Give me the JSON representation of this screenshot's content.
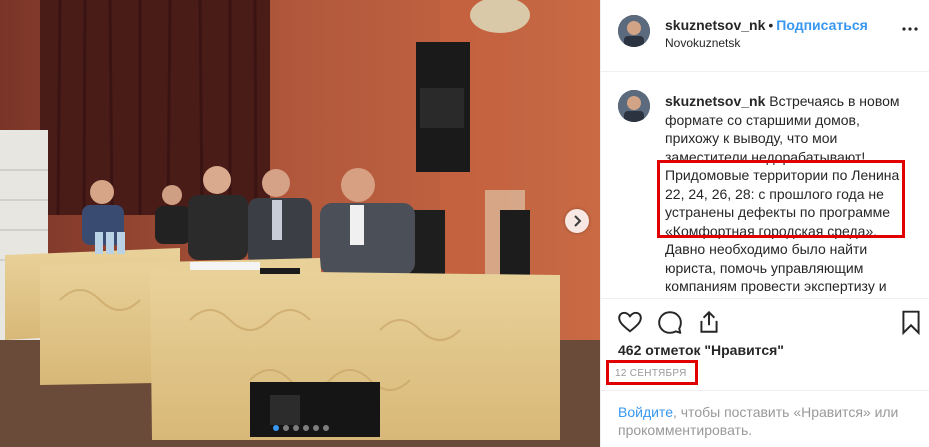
{
  "post": {
    "username": "skuznetsov_nk",
    "separator": "•",
    "follow_label": "Подписаться",
    "location": "Novokuznetsk",
    "caption_username": "skuznetsov_nk",
    "caption_text": "Встречаясь в новом формате со старшими домов, прихожу к выводу, что мои заместители недорабатывают! Придомовые территории по Ленина 22, 24, 26, 28: с прошлого года не устранены дефекты по программе «Комфортная городская среда». Давно необходимо было найти юриста, помочь управляющим компаниям провести экспертизу и",
    "likes": "462 отметок \"Нравится\"",
    "date": "12 СЕНТЯБРЯ",
    "login_link": "Войдите",
    "login_text": ", чтобы поставить «Нравится» или прокомментировать."
  },
  "carousel": {
    "slide_count": 6,
    "active_index": 0
  },
  "colors": {
    "accent": "#3897f0",
    "highlight": "#e00000",
    "text": "#262626",
    "muted": "#999999"
  },
  "icons": {
    "like": "heart-icon",
    "comment": "comment-icon",
    "share": "share-icon",
    "save": "bookmark-icon",
    "more": "more-icon",
    "next": "chevron-right-icon"
  }
}
